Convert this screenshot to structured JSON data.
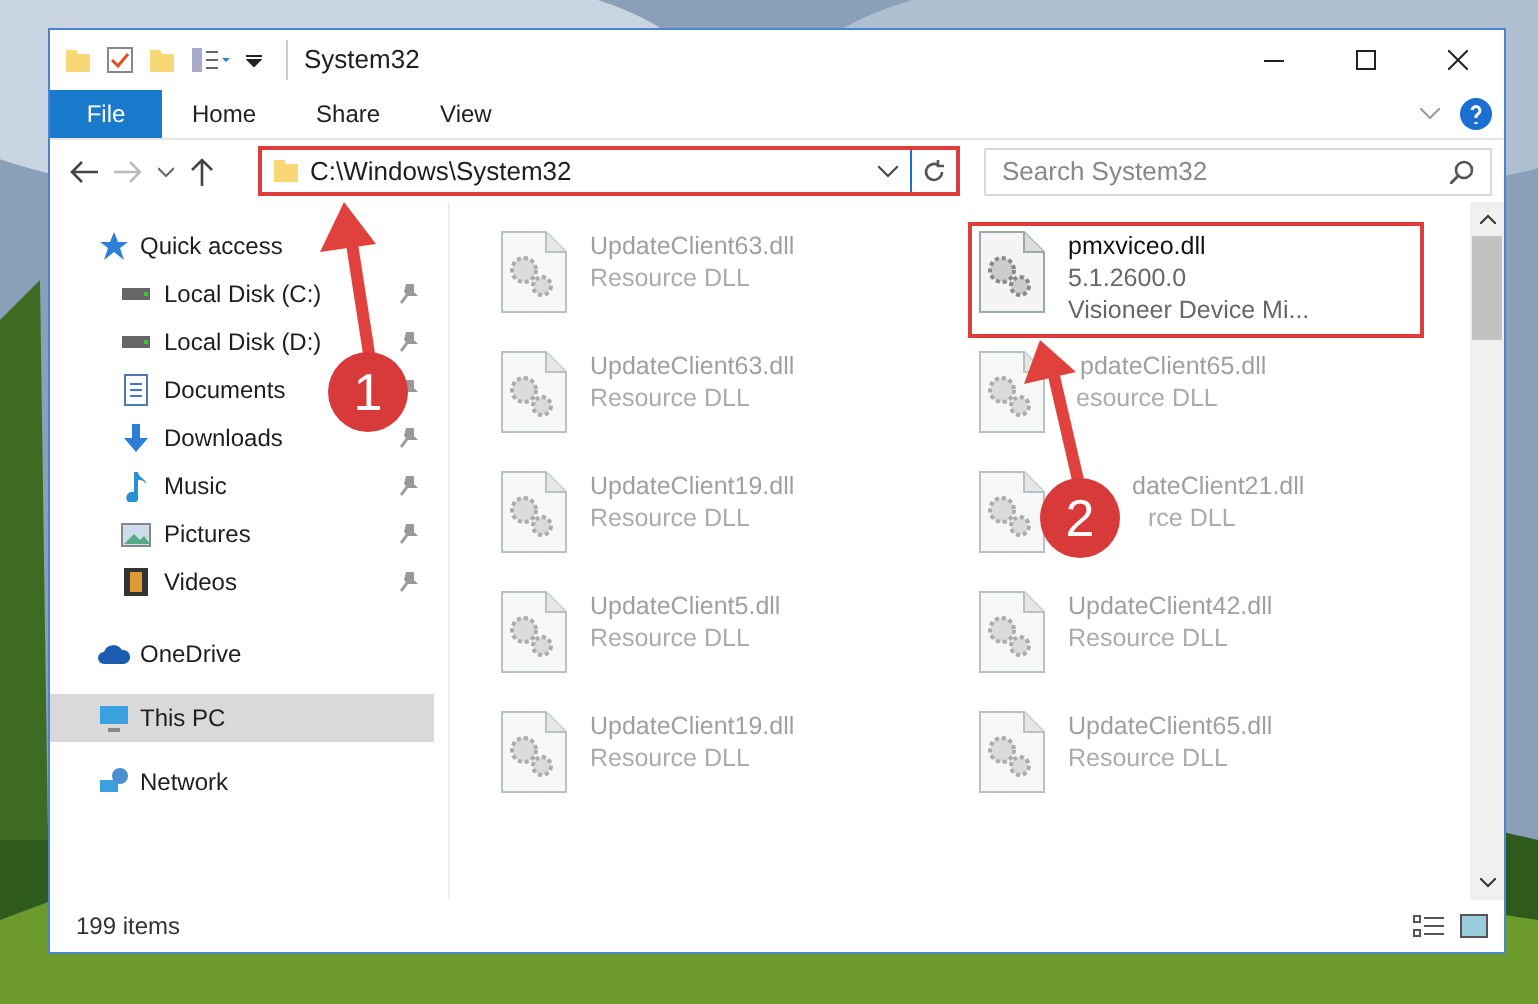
{
  "window": {
    "title": "System32"
  },
  "ribbon_tabs": [
    {
      "label": "File",
      "selected": true
    },
    {
      "label": "Home",
      "selected": false
    },
    {
      "label": "Share",
      "selected": false
    },
    {
      "label": "View",
      "selected": false
    }
  ],
  "address_bar": {
    "path": "C:\\Windows\\System32",
    "highlighted": true
  },
  "search": {
    "placeholder": "Search System32"
  },
  "sidebar": {
    "items": [
      {
        "label": "Quick access",
        "selected": false,
        "children": [
          {
            "label": "Local Disk (C:)",
            "pinned": true
          },
          {
            "label": "Local Disk (D:)",
            "pinned": true
          },
          {
            "label": "Documents",
            "pinned": true
          },
          {
            "label": "Downloads",
            "pinned": true
          },
          {
            "label": "Music",
            "pinned": true
          },
          {
            "label": "Pictures",
            "pinned": true
          },
          {
            "label": "Videos",
            "pinned": true
          }
        ]
      },
      {
        "label": "OneDrive",
        "selected": false
      },
      {
        "label": "This PC",
        "selected": true
      },
      {
        "label": "Network",
        "selected": false
      }
    ]
  },
  "files": [
    {
      "name": "UpdateClient63.dll",
      "detail": "Resource DLL",
      "dimmed": true,
      "highlighted": false
    },
    {
      "name": "pmxviceo.dll",
      "detail": "5.1.2600.0",
      "description": "Visioneer Device Mi...",
      "dimmed": false,
      "highlighted": true
    },
    {
      "name": "UpdateClient63.dll",
      "detail": "Resource DLL",
      "dimmed": true,
      "highlighted": false
    },
    {
      "name": "pdateClient65.dll",
      "detail": "esource DLL",
      "dimmed": true,
      "highlighted": false
    },
    {
      "name": "UpdateClient19.dll",
      "detail": "Resource DLL",
      "dimmed": true,
      "highlighted": false
    },
    {
      "name": "dateClient21.dll",
      "detail": "rce DLL",
      "dimmed": true,
      "highlighted": false
    },
    {
      "name": "UpdateClient5.dll",
      "detail": "Resource DLL",
      "dimmed": true,
      "highlighted": false
    },
    {
      "name": "UpdateClient42.dll",
      "detail": "Resource DLL",
      "dimmed": true,
      "highlighted": false
    },
    {
      "name": "UpdateClient19.dll",
      "detail": "Resource DLL",
      "dimmed": true,
      "highlighted": false
    },
    {
      "name": "UpdateClient65.dll",
      "detail": "Resource DLL",
      "dimmed": true,
      "highlighted": false
    }
  ],
  "status_bar": {
    "item_count": "199 items"
  },
  "annotations": [
    {
      "label": "1"
    },
    {
      "label": "2"
    }
  ]
}
